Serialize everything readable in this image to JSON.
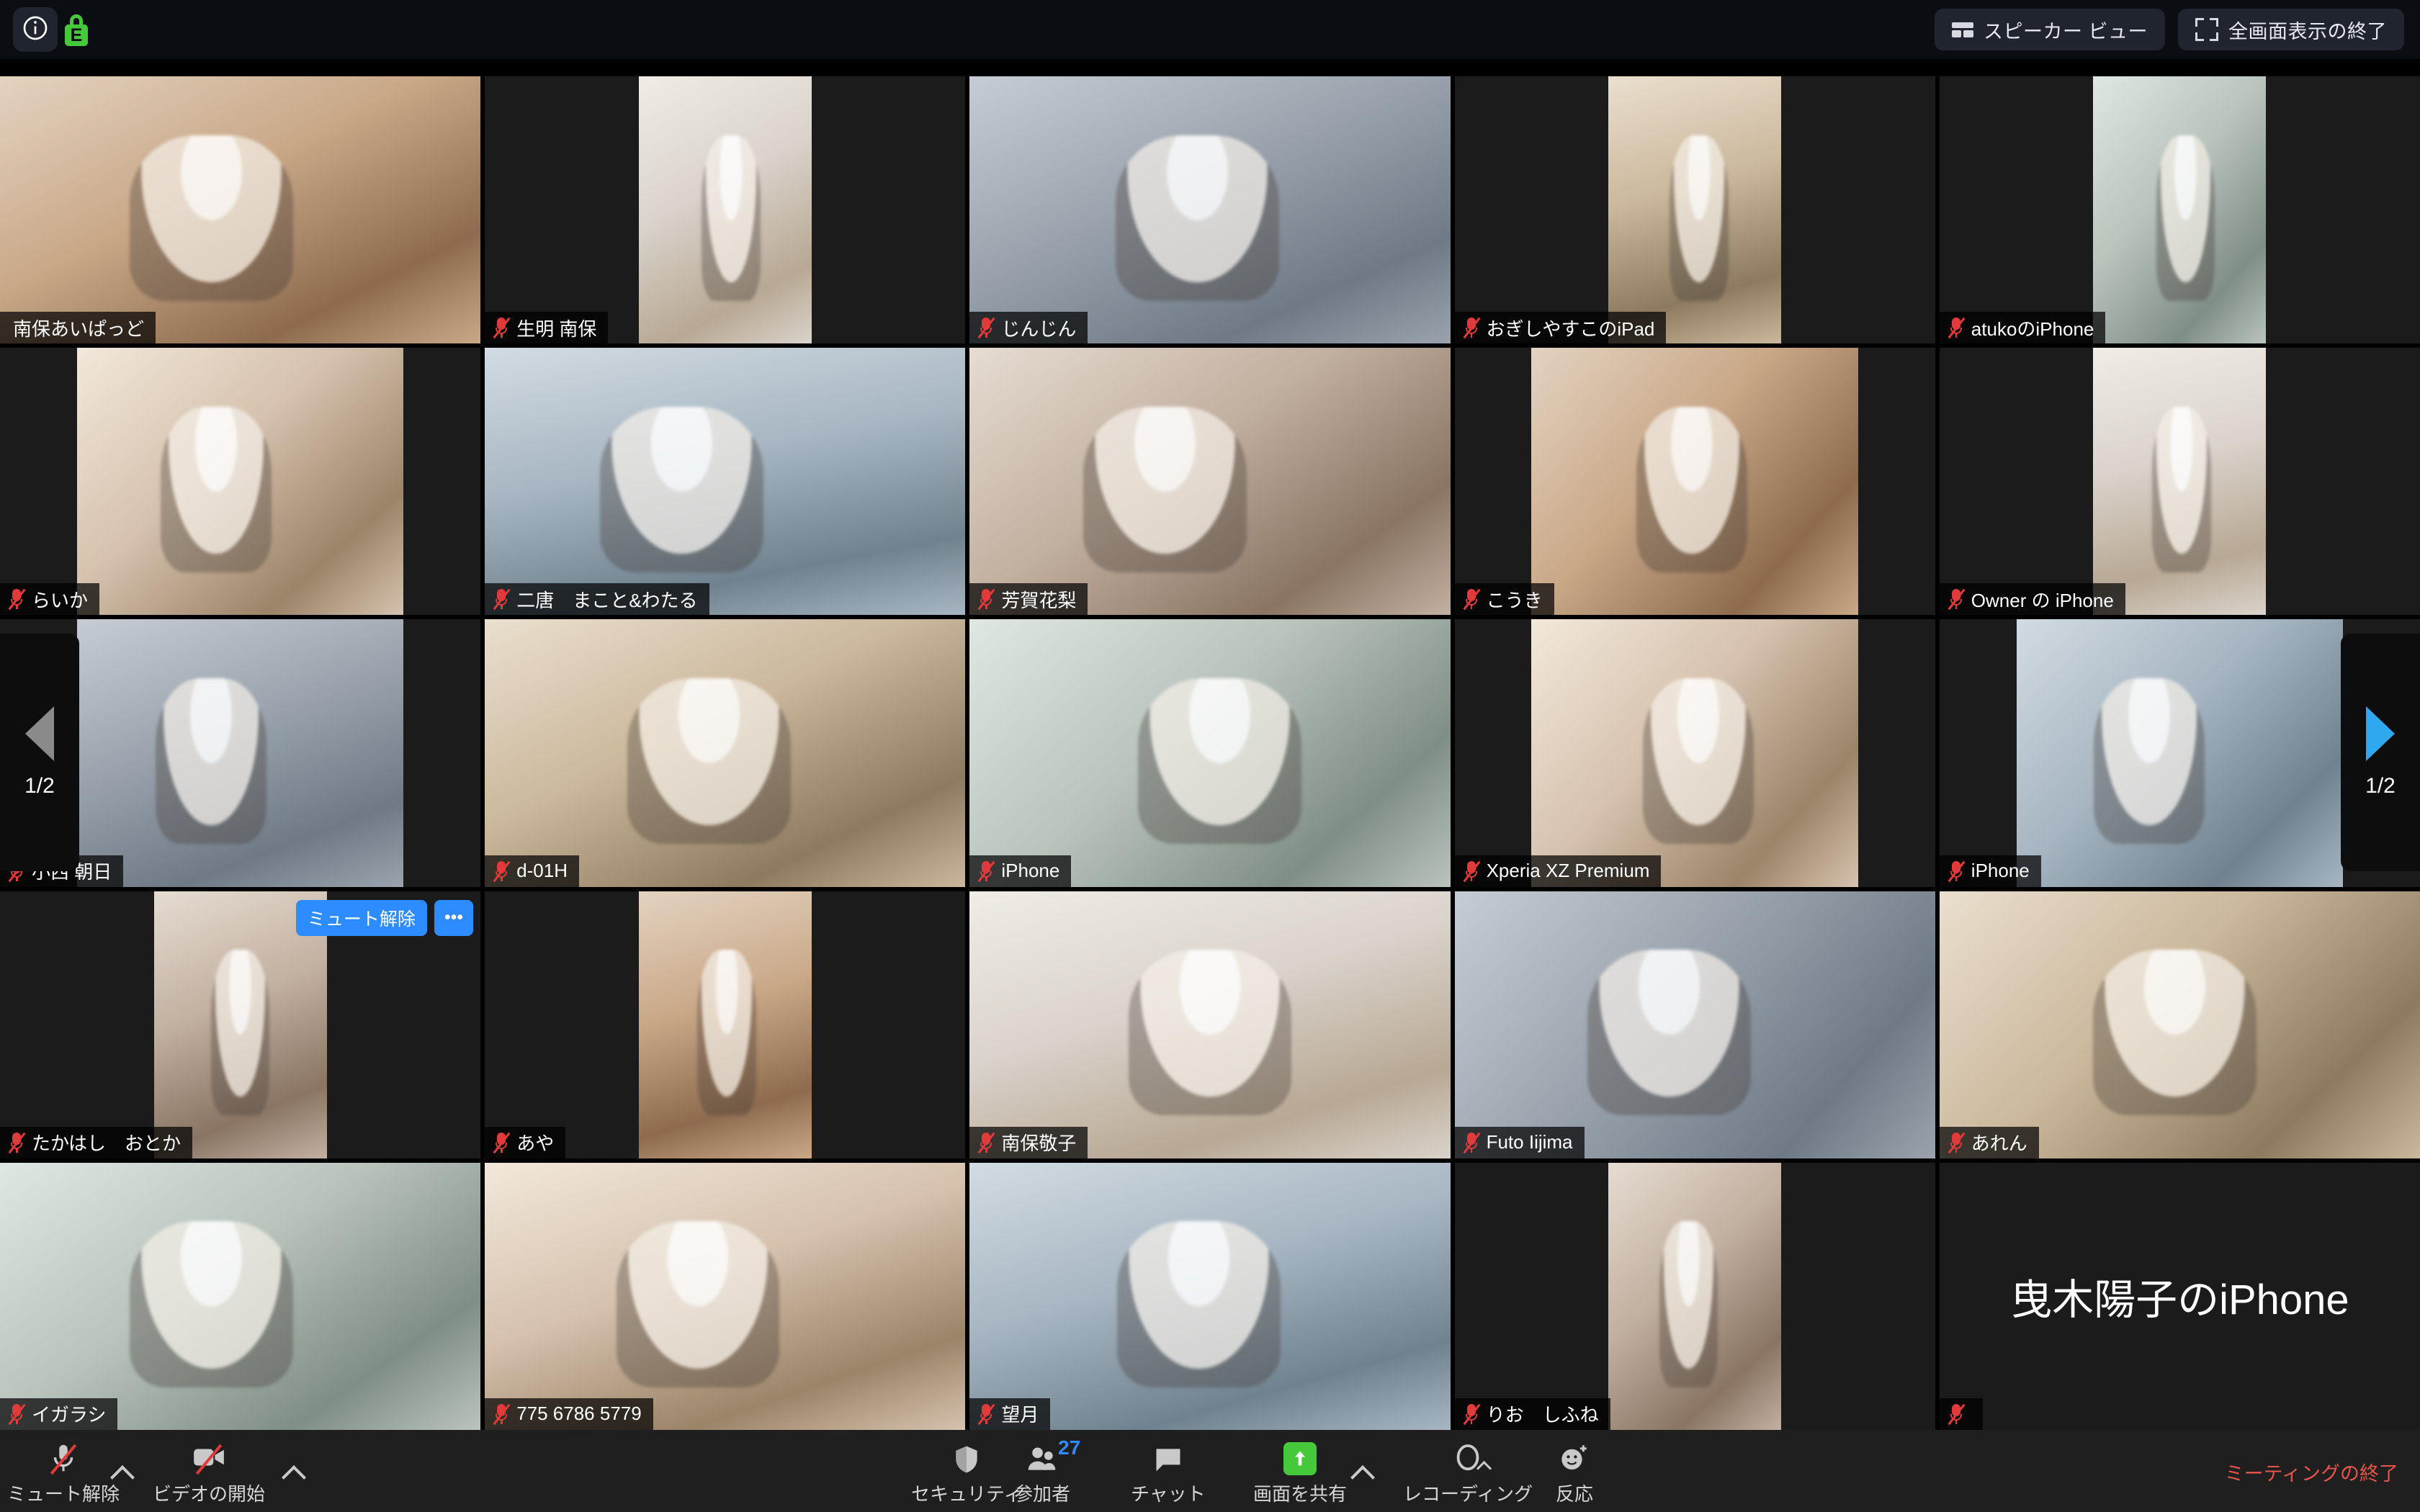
{
  "top_bar": {
    "info_icon": "info-icon",
    "encryption_icon": "encryption-lock-icon",
    "encryption_letter": "E",
    "speaker_view_label": "スピーカー ビュー",
    "exit_fullscreen_label": "全画面表示の終了"
  },
  "pager": {
    "left_label": "1/2",
    "right_label": "1/2",
    "left_arrow_icon": "chevron-left-icon",
    "right_arrow_icon": "chevron-right-icon"
  },
  "hover_controls": {
    "unmute_label": "ミュート解除",
    "more_label": "•••"
  },
  "participants": [
    {
      "name": "南保あいぱっど",
      "row": 0,
      "col": 0,
      "muted": false,
      "active": true,
      "video": true,
      "ar": "wide"
    },
    {
      "name": "生明 南保",
      "row": 0,
      "col": 1,
      "muted": true,
      "active": false,
      "video": true,
      "ar": "portrait"
    },
    {
      "name": "じんじん",
      "row": 0,
      "col": 2,
      "muted": true,
      "active": false,
      "video": true,
      "ar": "wide"
    },
    {
      "name": "おぎしやすこのiPad",
      "row": 0,
      "col": 3,
      "muted": true,
      "active": false,
      "video": true,
      "ar": "portrait"
    },
    {
      "name": "atukoのiPhone",
      "row": 0,
      "col": 4,
      "muted": true,
      "active": false,
      "video": true,
      "ar": "portrait"
    },
    {
      "name": "らいか",
      "row": 1,
      "col": 0,
      "muted": true,
      "active": false,
      "video": true,
      "ar": "portrait-w"
    },
    {
      "name": "二唐　まこと&わたる",
      "row": 1,
      "col": 1,
      "muted": true,
      "active": false,
      "video": true,
      "ar": "wide"
    },
    {
      "name": "芳賀花梨",
      "row": 1,
      "col": 2,
      "muted": true,
      "active": false,
      "video": true,
      "ar": "wide"
    },
    {
      "name": "こうき",
      "row": 1,
      "col": 3,
      "muted": true,
      "active": false,
      "video": true,
      "ar": "portrait-w"
    },
    {
      "name": "Owner の iPhone",
      "row": 1,
      "col": 4,
      "muted": true,
      "active": false,
      "video": true,
      "ar": "portrait"
    },
    {
      "name": "小西 朝日",
      "row": 2,
      "col": 0,
      "muted": true,
      "active": false,
      "video": true,
      "ar": "portrait-w"
    },
    {
      "name": "d-01H",
      "row": 2,
      "col": 1,
      "muted": true,
      "active": false,
      "video": true,
      "ar": "wide"
    },
    {
      "name": "iPhone",
      "row": 2,
      "col": 2,
      "muted": true,
      "active": false,
      "video": true,
      "ar": "wide"
    },
    {
      "name": "Xperia XZ Premium",
      "row": 2,
      "col": 3,
      "muted": true,
      "active": false,
      "video": true,
      "ar": "portrait-w"
    },
    {
      "name": "iPhone",
      "row": 2,
      "col": 4,
      "muted": true,
      "active": false,
      "video": true,
      "ar": "portrait-w"
    },
    {
      "name": "たかはし　おとか",
      "row": 3,
      "col": 0,
      "muted": true,
      "active": false,
      "video": true,
      "ar": "portrait"
    },
    {
      "name": "あや",
      "row": 3,
      "col": 1,
      "muted": true,
      "active": false,
      "video": true,
      "ar": "portrait"
    },
    {
      "name": "南保敬子",
      "row": 3,
      "col": 2,
      "muted": true,
      "active": false,
      "video": true,
      "ar": "wide"
    },
    {
      "name": "Futo Iijima",
      "row": 3,
      "col": 3,
      "muted": true,
      "active": false,
      "video": true,
      "ar": "wide"
    },
    {
      "name": "あれん",
      "row": 3,
      "col": 4,
      "muted": true,
      "active": false,
      "video": true,
      "ar": "wide"
    },
    {
      "name": "イガラシ",
      "row": 4,
      "col": 0,
      "muted": true,
      "active": false,
      "video": true,
      "ar": "wide"
    },
    {
      "name": "775 6786 5779",
      "row": 4,
      "col": 1,
      "muted": true,
      "active": false,
      "video": true,
      "ar": "wide"
    },
    {
      "name": "望月",
      "row": 4,
      "col": 2,
      "muted": true,
      "active": false,
      "video": true,
      "ar": "wide"
    },
    {
      "name": "りお　しふね",
      "row": 4,
      "col": 3,
      "muted": true,
      "active": false,
      "video": true,
      "ar": "portrait"
    },
    {
      "name": "",
      "row": 4,
      "col": 4,
      "muted": true,
      "active": false,
      "video": false,
      "ar": "wide",
      "display_name": "曳木陽子のiPhone"
    }
  ],
  "toolbar": {
    "mute_label": "ミュート解除",
    "video_label": "ビデオの開始",
    "security_label": "セキュリティ",
    "participants_label": "参加者",
    "participants_count": "27",
    "chat_label": "チャット",
    "share_label": "画面を共有",
    "record_label": "レコーディング",
    "reactions_label": "反応",
    "end_label": "ミーティングの終了",
    "mic_icon": "microphone-muted-icon",
    "camera_icon": "camera-muted-icon",
    "security_icon": "shield-icon",
    "participants_icon": "people-icon",
    "chat_icon": "chat-bubble-icon",
    "share_icon": "share-screen-icon",
    "record_icon": "record-circle-icon",
    "reactions_icon": "smiley-plus-icon"
  },
  "colors": {
    "accent_blue": "#2d8cff",
    "share_green": "#45c93a",
    "end_red": "#e8544a",
    "active_border": "#b9d36b",
    "mute_red": "#e03a3a"
  }
}
